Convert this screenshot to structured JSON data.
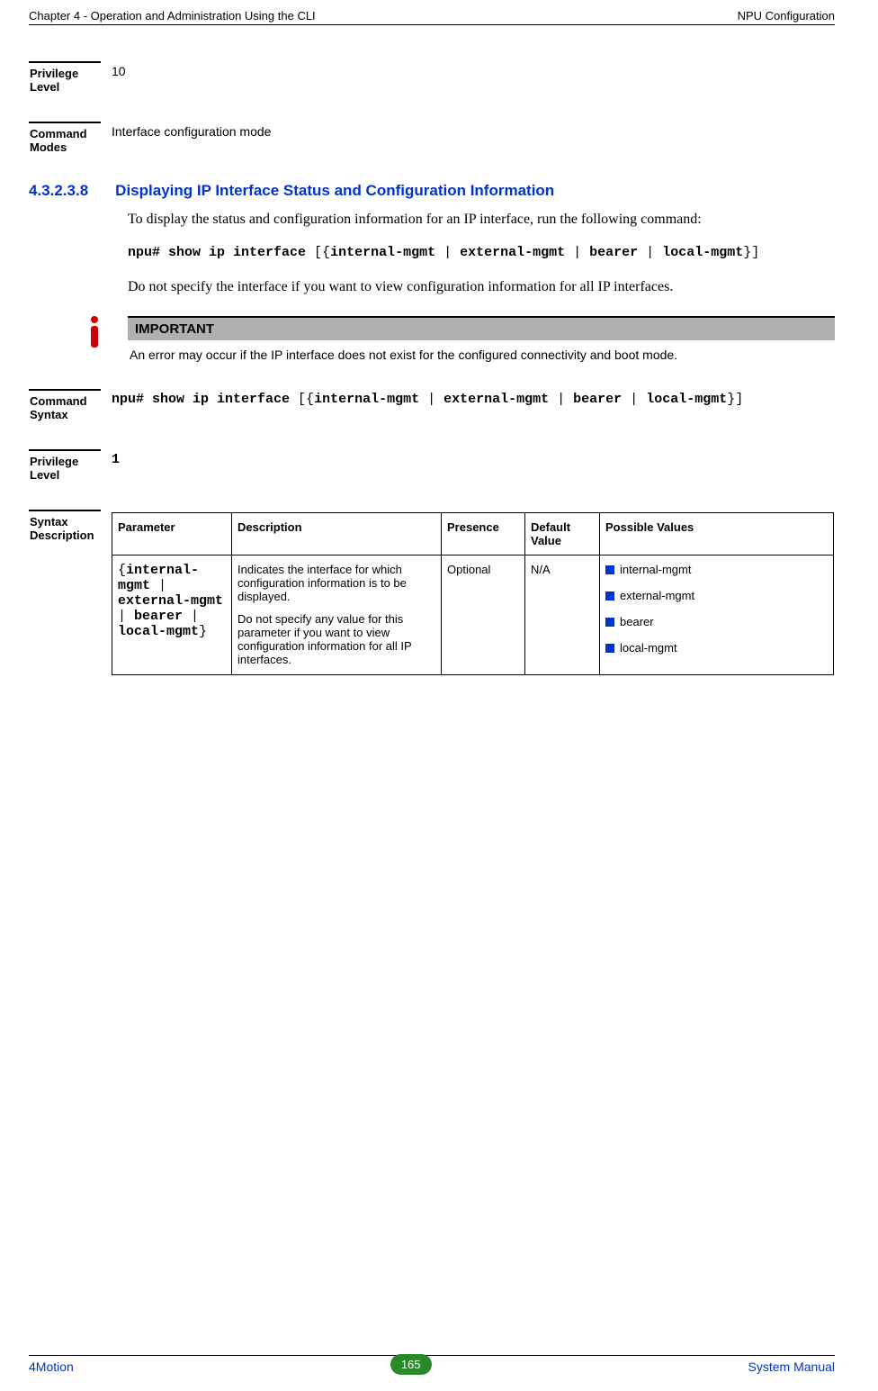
{
  "header": {
    "left": "Chapter 4 - Operation and Administration Using the CLI",
    "right": "NPU Configuration"
  },
  "block1": {
    "label": "Privilege Level",
    "value": "10"
  },
  "block2": {
    "label": "Command Modes",
    "value": "Interface configuration mode"
  },
  "section": {
    "number": "4.3.2.3.8",
    "title": "Displaying IP Interface Status and Configuration Information",
    "para1": "To display the status and configuration information for an IP interface, run the following command:",
    "cmd_pre": "npu# show ip interface ",
    "cmd_open": "[{",
    "cmd_a": "internal-mgmt",
    "cmd_sep": " | ",
    "cmd_b": "external-mgmt",
    "cmd_c": "bearer",
    "cmd_d": "local-mgmt",
    "cmd_close": "}]",
    "para2": "Do not specify the interface if you want to view configuration information for all IP interfaces."
  },
  "important": {
    "title": "IMPORTANT",
    "text": "An error may occur if the IP interface does not exist for the configured connectivity and boot mode."
  },
  "block3": {
    "label": "Command Syntax",
    "cmd_pre": "npu# show ip interface ",
    "cmd_open": "[{",
    "cmd_a": "internal-mgmt",
    "cmd_sep": " | ",
    "cmd_b": "external-mgmt",
    "cmd_c": "bearer",
    "cmd_d": "local-mgmt",
    "cmd_close": "}]"
  },
  "block4": {
    "label": "Privilege Level",
    "value": "1"
  },
  "block5": {
    "label": "Syntax Description"
  },
  "table": {
    "h1": "Parameter",
    "h2": "Description",
    "h3": "Presence",
    "h4": "Default Value",
    "h5": "Possible Values",
    "param_open": "{",
    "param_a": "internal-mgmt",
    "param_sep": " | ",
    "param_b": "external-mgmt",
    "param_c": "bearer",
    "param_d": "local-mgmt",
    "param_close": "}",
    "desc1": "Indicates the interface for which configuration information is to be displayed.",
    "desc2": "Do not specify any value for this parameter if you want to view configuration information for all IP interfaces.",
    "presence": "Optional",
    "default": "N/A",
    "pv1": "internal-mgmt",
    "pv2": "external-mgmt",
    "pv3": "bearer",
    "pv4": "local-mgmt"
  },
  "footer": {
    "left": "4Motion",
    "center": "165",
    "right": "System Manual"
  }
}
